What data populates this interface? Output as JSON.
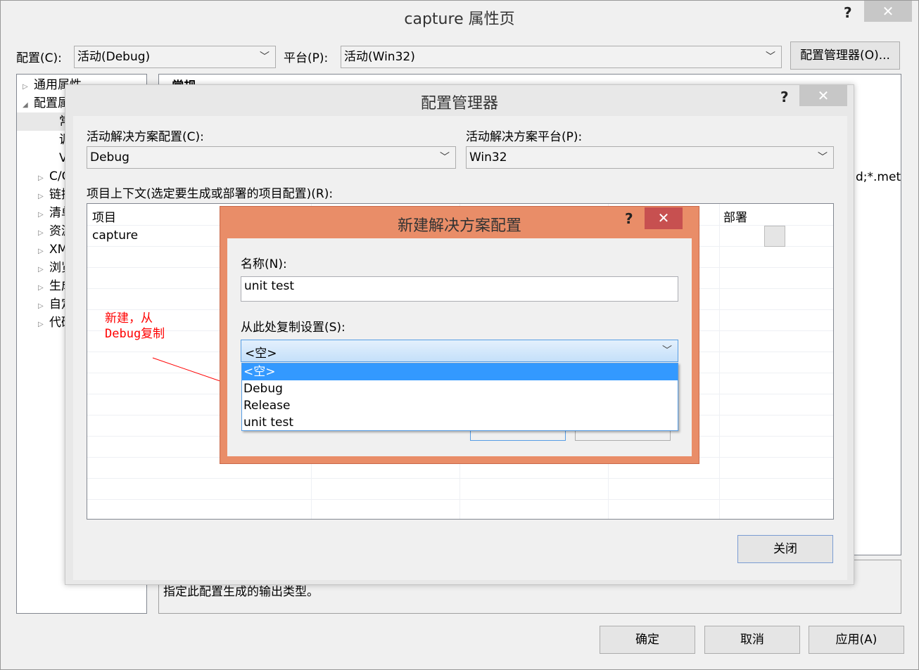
{
  "window": {
    "title": "capture 属性页",
    "help": "?",
    "close": "✕"
  },
  "top": {
    "config_label": "配置(C):",
    "config_value": "活动(Debug)",
    "platform_label": "平台(P):",
    "platform_value": "活动(Win32)",
    "manager_button": "配置管理器(O)..."
  },
  "tree": {
    "items": [
      {
        "label": "通用属性",
        "arrow": "▷"
      },
      {
        "label": "配置属性",
        "arrow": "◢"
      },
      {
        "label": "常规",
        "arrow": ""
      },
      {
        "label": "调试",
        "arrow": ""
      },
      {
        "label": "VC++目录",
        "arrow": ""
      },
      {
        "label": "C/C++",
        "arrow": "▷"
      },
      {
        "label": "链接器",
        "arrow": "▷"
      },
      {
        "label": "清单工具",
        "arrow": "▷"
      },
      {
        "label": "资源",
        "arrow": "▷"
      },
      {
        "label": "XML文档生成器",
        "arrow": "▷"
      },
      {
        "label": "浏览信息",
        "arrow": "▷"
      },
      {
        "label": "生成事件",
        "arrow": "▷"
      },
      {
        "label": "自定义生成步骤",
        "arrow": "▷"
      },
      {
        "label": "代码分析",
        "arrow": "▷"
      }
    ]
  },
  "props": {
    "section": "常规",
    "fragment": "d;*.meta",
    "description": "指定此配置生成的输出类型。"
  },
  "bottom": {
    "ok": "确定",
    "cancel": "取消",
    "apply": "应用(A)"
  },
  "manager": {
    "title": "配置管理器",
    "help": "?",
    "close": "✕",
    "active_config_label": "活动解决方案配置(C):",
    "active_config_value": "Debug",
    "active_platform_label": "活动解决方案平台(P):",
    "active_platform_value": "Win32",
    "context_label": "项目上下文(选定要生成或部署的项目配置)(R):",
    "columns": {
      "project": "项目",
      "deploy": "部署"
    },
    "rows": [
      {
        "project": "capture"
      }
    ],
    "close_button": "关闭"
  },
  "annotation": {
    "line1": "新建，从",
    "line2": "Debug复制",
    "color": "#ff0000"
  },
  "new_config": {
    "title": "新建解决方案配置",
    "help": "?",
    "close": "✕",
    "name_label": "名称(N):",
    "name_value": "unit test",
    "copy_label": "从此处复制设置(S):",
    "copy_value": "<空>",
    "options": [
      "<空>",
      "Debug",
      "Release",
      "unit test"
    ],
    "selected_index": 0,
    "accent": "#e98d68"
  }
}
